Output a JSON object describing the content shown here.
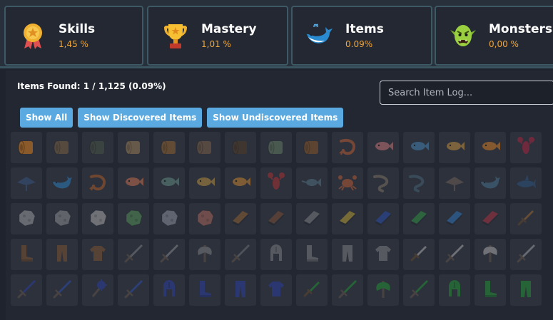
{
  "stats": [
    {
      "label": "Skills",
      "value": "1,45 %",
      "icon": "medal-icon"
    },
    {
      "label": "Mastery",
      "value": "1,01 %",
      "icon": "trophy-icon"
    },
    {
      "label": "Items",
      "value": "0.09%",
      "icon": "whale-icon"
    },
    {
      "label": "Monsters",
      "value": "0,00 %",
      "icon": "goblin-icon"
    }
  ],
  "item_log": {
    "found_text": "Items Found: 1 / 1,125 (0.09%)",
    "search_placeholder": "Search Item Log...",
    "filters": [
      "Show All",
      "Show Discovered Items",
      "Show Undiscovered Items"
    ]
  },
  "colors": {
    "accent": "#5aa9e0",
    "stat_value": "#f0a63a",
    "card_border": "#3d5965"
  },
  "grid_items": [
    {
      "icon": "log-icon",
      "color": "#8a5a2b",
      "discovered": true
    },
    {
      "icon": "log-icon",
      "color": "#8a6a44"
    },
    {
      "icon": "log-icon",
      "color": "#4f5a46"
    },
    {
      "icon": "log-icon",
      "color": "#b08a5a"
    },
    {
      "icon": "log-icon",
      "color": "#a56b2c"
    },
    {
      "icon": "log-icon",
      "color": "#8a6848"
    },
    {
      "icon": "log-icon",
      "color": "#5a3d23"
    },
    {
      "icon": "log-icon",
      "color": "#6f8a6a"
    },
    {
      "icon": "log-icon",
      "color": "#9a5d24"
    },
    {
      "icon": "shrimp-icon",
      "color": "#d06030"
    },
    {
      "icon": "fish-icon",
      "color": "#e08080"
    },
    {
      "icon": "fish-icon",
      "color": "#4a90c8"
    },
    {
      "icon": "fish-icon",
      "color": "#e0a040"
    },
    {
      "icon": "fish-icon",
      "color": "#f08a20"
    },
    {
      "icon": "lobster-icon",
      "color": "#c02040"
    },
    {
      "icon": "manta-ray-icon",
      "color": "#3a5a8a"
    },
    {
      "icon": "whale-icon",
      "color": "#2a8ad0"
    },
    {
      "icon": "shrimp-icon",
      "color": "#c06020"
    },
    {
      "icon": "fish-icon",
      "color": "#e07850"
    },
    {
      "icon": "fish-icon",
      "color": "#6a9a8a"
    },
    {
      "icon": "fish-icon",
      "color": "#d0a040"
    },
    {
      "icon": "fish-icon",
      "color": "#e09030"
    },
    {
      "icon": "lobster-icon",
      "color": "#c03030"
    },
    {
      "icon": "swordfish-icon",
      "color": "#5a7a8a"
    },
    {
      "icon": "crab-icon",
      "color": "#d06030"
    },
    {
      "icon": "eel-icon",
      "color": "#8a7a6a"
    },
    {
      "icon": "eel-icon",
      "color": "#4a6a7a"
    },
    {
      "icon": "manta-ray-icon",
      "color": "#7a6a5a"
    },
    {
      "icon": "whale-icon",
      "color": "#4a7a9a"
    },
    {
      "icon": "shark-icon",
      "color": "#2a5a8a"
    },
    {
      "icon": "ore-icon",
      "color": "#b0b0b0"
    },
    {
      "icon": "ore-icon",
      "color": "#a0a0a0"
    },
    {
      "icon": "ore-icon",
      "color": "#c0c0c0"
    },
    {
      "icon": "ore-icon",
      "color": "#5aa05a"
    },
    {
      "icon": "ore-icon",
      "color": "#a0a0b0"
    },
    {
      "icon": "ore-icon",
      "color": "#c07060"
    },
    {
      "icon": "bar-icon",
      "color": "#a06a30"
    },
    {
      "icon": "bar-icon",
      "color": "#8a5030"
    },
    {
      "icon": "bar-icon",
      "color": "#8a8a8a"
    },
    {
      "icon": "bar-icon",
      "color": "#d0b030"
    },
    {
      "icon": "bar-icon",
      "color": "#2a50c0"
    },
    {
      "icon": "bar-icon",
      "color": "#30a040"
    },
    {
      "icon": "bar-icon",
      "color": "#3080d0"
    },
    {
      "icon": "bar-icon",
      "color": "#c03040"
    },
    {
      "icon": "dagger-icon",
      "color": "#b07030"
    },
    {
      "icon": "boots-icon",
      "color": "#8a5a30"
    },
    {
      "icon": "legs-icon",
      "color": "#8a5a30"
    },
    {
      "icon": "body-icon",
      "color": "#8a5a30"
    },
    {
      "icon": "sword-icon",
      "color": "#8a8a8a"
    },
    {
      "icon": "sword-icon",
      "color": "#9a9a9a"
    },
    {
      "icon": "axe-icon",
      "color": "#8a8a8a"
    },
    {
      "icon": "sword-icon",
      "color": "#7a7a7a"
    },
    {
      "icon": "helmet-icon",
      "color": "#8a8a8a"
    },
    {
      "icon": "boots-icon",
      "color": "#8a8a8a"
    },
    {
      "icon": "legs-icon",
      "color": "#8a8a8a"
    },
    {
      "icon": "body-icon",
      "color": "#8a8a8a"
    },
    {
      "icon": "dagger-icon",
      "color": "#c0c0c0"
    },
    {
      "icon": "sword-icon",
      "color": "#c0c0c0"
    },
    {
      "icon": "axe-icon",
      "color": "#c0c0c0"
    },
    {
      "icon": "sword-icon",
      "color": "#b0b0b0"
    },
    {
      "icon": "sword-icon",
      "color": "#2a40b0"
    },
    {
      "icon": "sword-icon",
      "color": "#3050c0"
    },
    {
      "icon": "mace-icon",
      "color": "#2a40b0"
    },
    {
      "icon": "sword-icon",
      "color": "#3050c0"
    },
    {
      "icon": "helmet-icon",
      "color": "#2a40b0"
    },
    {
      "icon": "boots-icon",
      "color": "#2a40b0"
    },
    {
      "icon": "legs-icon",
      "color": "#2a40b0"
    },
    {
      "icon": "body-icon",
      "color": "#2a40b0"
    },
    {
      "icon": "dagger-icon",
      "color": "#20a030"
    },
    {
      "icon": "sword-icon",
      "color": "#20a030"
    },
    {
      "icon": "axe-icon",
      "color": "#20a030"
    },
    {
      "icon": "sword-icon",
      "color": "#20a030"
    },
    {
      "icon": "helmet-icon",
      "color": "#20a030"
    },
    {
      "icon": "boots-icon",
      "color": "#20a030"
    },
    {
      "icon": "legs-icon",
      "color": "#20a030"
    }
  ]
}
